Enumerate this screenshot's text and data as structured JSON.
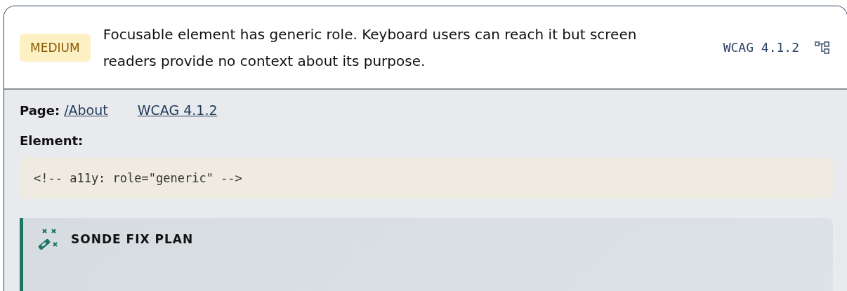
{
  "issue": {
    "severity": {
      "label": "MEDIUM",
      "kind": "medium"
    },
    "message": "Focusable element has generic role. Keyboard users can reach it but screen readers provide no context about its purpose.",
    "criterion": "WCAG 4.1.2"
  },
  "details": {
    "page_label": "Page:",
    "page_link": "/About",
    "criterion_link": "WCAG 4.1.2",
    "element_label": "Element:",
    "element_code": "<!-- a11y: role=\"generic\" -->"
  },
  "fix_plan": {
    "title": "SONDE FIX PLAN"
  }
}
